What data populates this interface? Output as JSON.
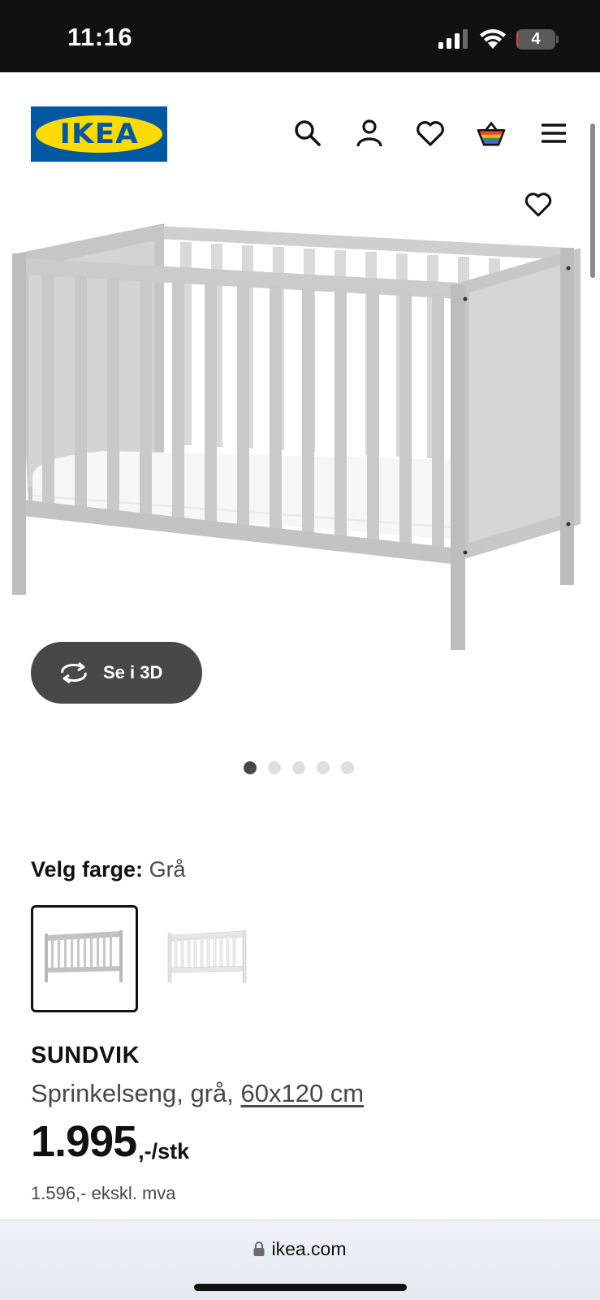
{
  "status_bar": {
    "time": "11:16",
    "battery_level": "4",
    "icons": [
      "cellular-signal-icon",
      "wifi-icon",
      "battery-icon"
    ]
  },
  "header": {
    "logo_text": "IKEA",
    "icons": [
      "search-icon",
      "user-icon",
      "heart-icon",
      "basket-icon",
      "menu-icon"
    ]
  },
  "gallery": {
    "view_3d_label": "Se i 3D",
    "dot_count": 5,
    "active_index": 0
  },
  "color_selector": {
    "label": "Velg farge:",
    "value": "Grå",
    "options": [
      "grey-crib",
      "white-crib"
    ]
  },
  "product": {
    "name": "SUNDVIK",
    "description": "Sprinkelseng, grå, ",
    "size": "60x120 cm",
    "price": "1.995",
    "price_suffix": ",-/stk",
    "price_ex_vat": "1.596,- ekskl. mva"
  },
  "browser": {
    "url": "ikea.com"
  },
  "colors": {
    "ikea_blue": "#0058a3",
    "ikea_yellow": "#ffdb00",
    "button_dark": "#484848",
    "crib_grey": "#c9c9c9"
  }
}
